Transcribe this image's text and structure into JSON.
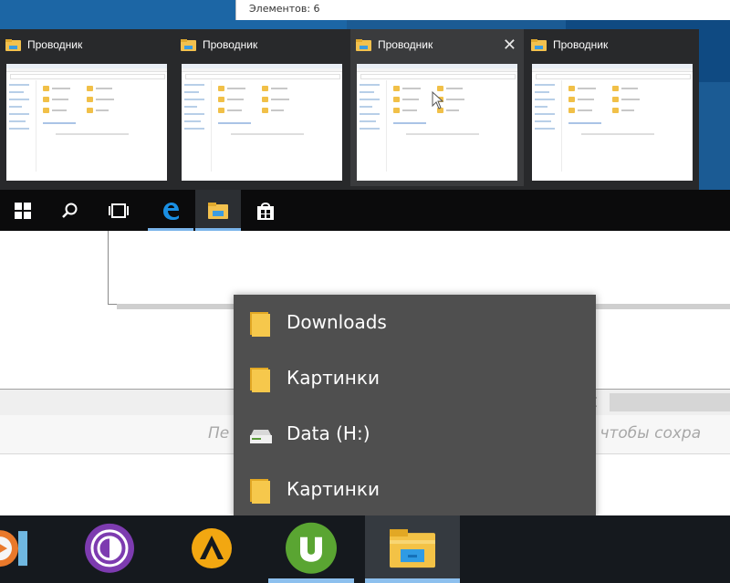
{
  "explorer_strip": {
    "items_count": "Элементов: 6"
  },
  "thumbnails": [
    {
      "title": "Проводник",
      "icon": "file-explorer-icon",
      "hovered": false,
      "close": ""
    },
    {
      "title": "Проводник",
      "icon": "file-explorer-icon",
      "hovered": false,
      "close": ""
    },
    {
      "title": "Проводник",
      "icon": "file-explorer-icon",
      "hovered": true,
      "close": "✕"
    },
    {
      "title": "Проводник",
      "icon": "file-explorer-icon",
      "hovered": false,
      "close": ""
    }
  ],
  "top_taskbar": {
    "buttons": [
      {
        "icon": "windows-start-icon"
      },
      {
        "icon": "search-icon"
      },
      {
        "icon": "task-view-icon"
      },
      {
        "icon": "edge-icon"
      },
      {
        "icon": "file-explorer-icon",
        "active": true
      },
      {
        "icon": "store-icon"
      }
    ]
  },
  "background_window": {
    "hint_left": "Пе",
    "hint_right": "), чтобы сохра",
    "close_mark": "×"
  },
  "jump_list": {
    "items": [
      {
        "label": "Downloads",
        "icon": "folder-icon"
      },
      {
        "label": "Картинки",
        "icon": "folder-icon"
      },
      {
        "label": "Data (H:)",
        "icon": "drive-icon"
      },
      {
        "label": "Картинки",
        "icon": "folder-icon"
      }
    ]
  },
  "bottom_taskbar": {
    "buttons": [
      {
        "icon": "media-player-icon"
      },
      {
        "icon": "tor-browser-icon"
      },
      {
        "icon": "aimp-icon"
      },
      {
        "icon": "utorrent-icon",
        "running": true
      },
      {
        "icon": "file-explorer-icon",
        "active": true
      }
    ]
  },
  "colors": {
    "taskbar": "#15191e",
    "accent": "#8dc0ee",
    "jumplist_bg": "#4f4f4f",
    "folder": "#f1c048"
  }
}
